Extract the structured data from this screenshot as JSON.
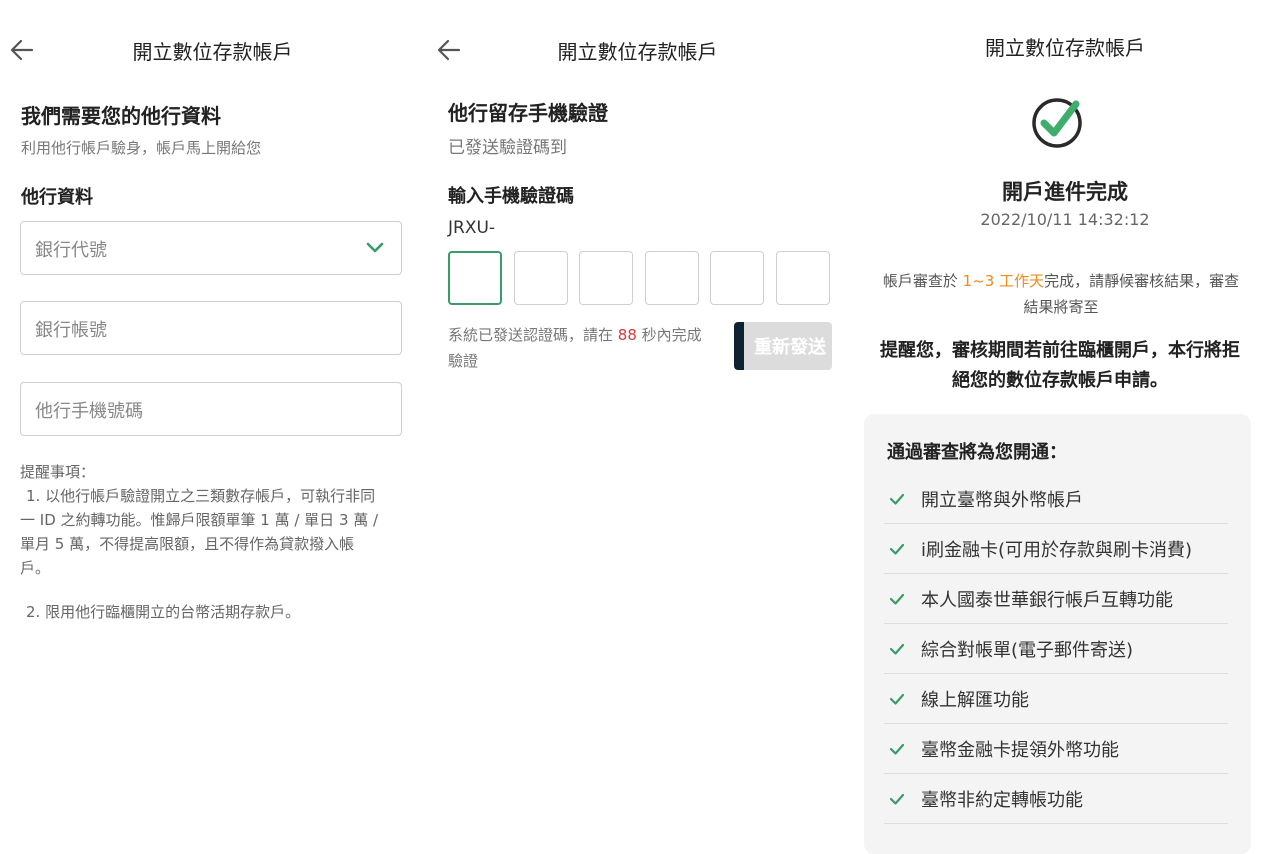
{
  "colors": {
    "accent": "#3a9a6a",
    "highlight_orange": "#f08a1a",
    "countdown_red": "#d23c3c",
    "resend_bg": "#dcdcdc"
  },
  "screen1": {
    "title": "開立數位存款帳戶",
    "heading": "我們需要您的他行資料",
    "subheading": "利用他行帳戶驗身，帳戶馬上開給您",
    "section_label": "他行資料",
    "fields": {
      "bank_code_placeholder": "銀行代號",
      "bank_account_placeholder": "銀行帳號",
      "mobile_placeholder": "他行手機號碼"
    },
    "notes": {
      "title": "提醒事項：",
      "item1_lines": [
        "1. 以他行帳戶驗證開立之三類數存帳戶，可執行非同",
        "一 ID 之約轉功能。惟歸戶限額單筆 1 萬 / 單日 3 萬 /",
        "單月 5 萬，不得提高限額，且不得作為貸款撥入帳",
        "戶。"
      ],
      "item2": "2. 限用他行臨櫃開立的台幣活期存款戶。"
    }
  },
  "screen2": {
    "title": "開立數位存款帳戶",
    "heading": "他行留存手機驗證",
    "subheading": "已發送驗證碼到",
    "code_heading": "輸入手機驗證碼",
    "code_prefix": "JRXU-",
    "otp_digits": 6,
    "hint_before": "系統已發送認證碼，請在",
    "hint_count": "88",
    "hint_after_line1": "秒內完成",
    "hint_line2": "驗證",
    "resend_label": "重新發送"
  },
  "screen3": {
    "title": "開立數位存款帳戶",
    "done_title": "開戶進件完成",
    "timestamp": "2022/10/11 14:32:12",
    "review_before": "帳戶審查於",
    "review_highlight": "1~3 工作天",
    "review_after": "完成，請靜候審核結果，審查",
    "review_line2": "結果將寄至",
    "remind_line1": "提醒您，審核期間若前往臨櫃開戶，本行將拒",
    "remind_line2": "絕您的數位存款帳戶申請。",
    "box_title": "通過審查將為您開通：",
    "features": [
      "開立臺幣與外幣帳戶",
      "i刷金融卡(可用於存款與刷卡消費)",
      "本人國泰世華銀行帳戶互轉功能",
      "綜合對帳單(電子郵件寄送)",
      "線上解匯功能",
      "臺幣金融卡提領外幣功能",
      "臺幣非約定轉帳功能"
    ]
  }
}
